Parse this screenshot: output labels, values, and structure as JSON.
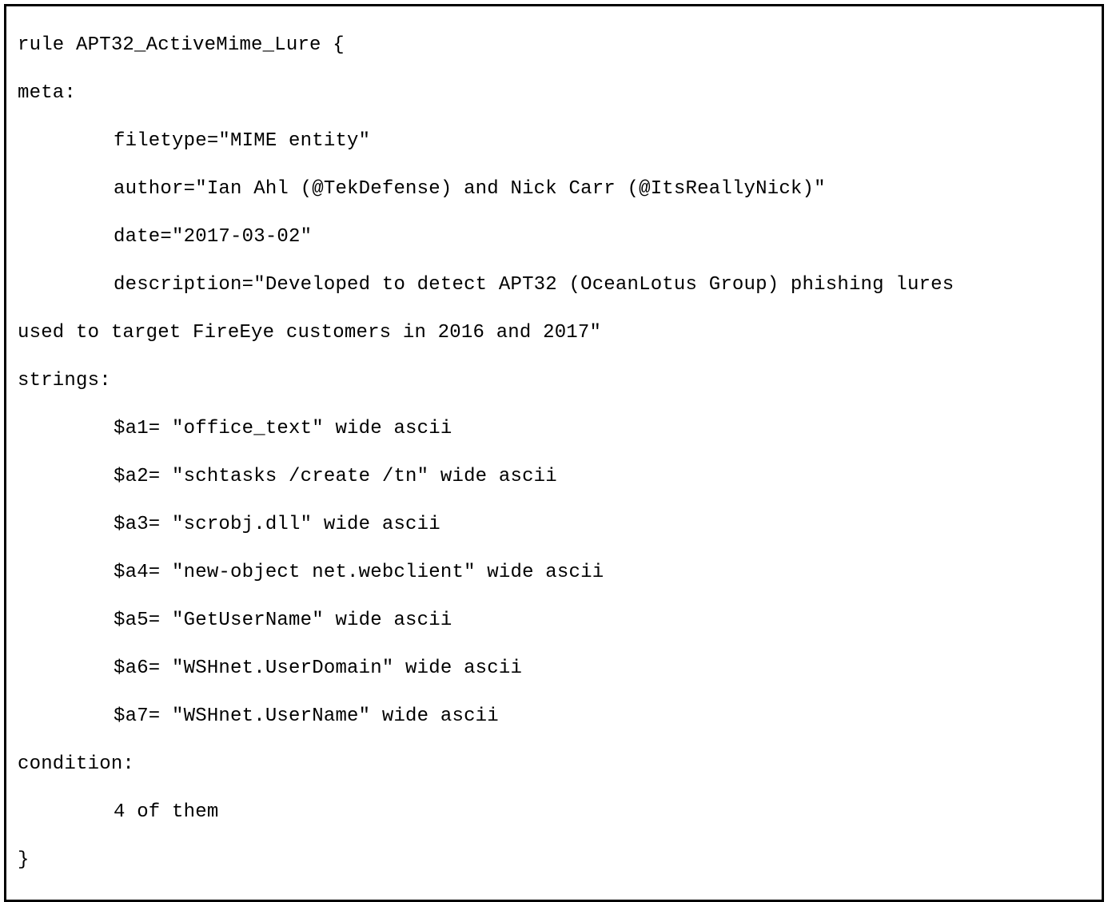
{
  "yara_rule": {
    "header": "rule APT32_ActiveMime_Lure {",
    "meta_label": "meta:",
    "meta": {
      "filetype": "filetype=\"MIME entity\"",
      "author": "author=\"Ian Ahl (@TekDefense) and Nick Carr (@ItsReallyNick)\"",
      "date": "date=\"2017-03-02\"",
      "description_line1": "description=\"Developed to detect APT32 (OceanLotus Group) phishing lures",
      "description_line2": "used to target FireEye customers in 2016 and 2017\""
    },
    "strings_label": "strings:",
    "strings": {
      "a1": "$a1= \"office_text\" wide ascii",
      "a2": "$a2= \"schtasks /create /tn\" wide ascii",
      "a3": "$a3= \"scrobj.dll\" wide ascii",
      "a4": "$a4= \"new-object net.webclient\" wide ascii",
      "a5": "$a5= \"GetUserName\" wide ascii",
      "a6": "$a6= \"WSHnet.UserDomain\" wide ascii",
      "a7": "$a7= \"WSHnet.UserName\" wide ascii"
    },
    "condition_label": "condition:",
    "condition": "4 of them",
    "footer": "}"
  }
}
